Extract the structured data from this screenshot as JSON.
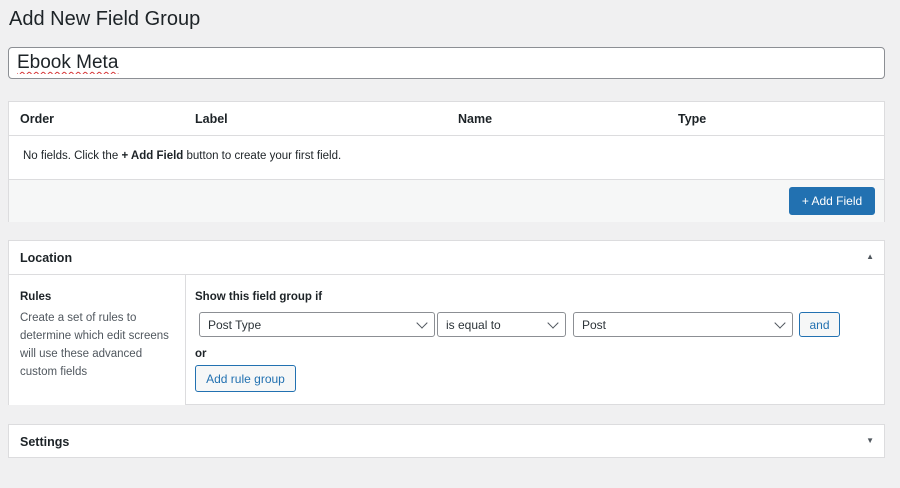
{
  "page": {
    "title": "Add New Field Group"
  },
  "title_input": {
    "value": "Ebook Meta"
  },
  "fields": {
    "columns": [
      "Order",
      "Label",
      "Name",
      "Type"
    ],
    "empty_message": {
      "before": "No fields. Click the ",
      "link": "+ Add Field",
      "after": " button to create your first field."
    },
    "add_button": "+ Add Field"
  },
  "location": {
    "title": "Location",
    "toggle_icon": "▲",
    "rules_label": "Rules",
    "rules_description": "Create a set of rules to determine which edit screens will use these advanced custom fields",
    "show_if": "Show this field group if",
    "param_select": "Post Type",
    "operator_select": "is equal to",
    "value_select": "Post",
    "and_button": "and",
    "or_label": "or",
    "add_rule_group_button": "Add rule group"
  },
  "settings": {
    "title": "Settings",
    "toggle_icon": "▼"
  },
  "colors": {
    "primary": "#2271b1",
    "background": "#f0f0f1",
    "border": "#dcdcde"
  }
}
